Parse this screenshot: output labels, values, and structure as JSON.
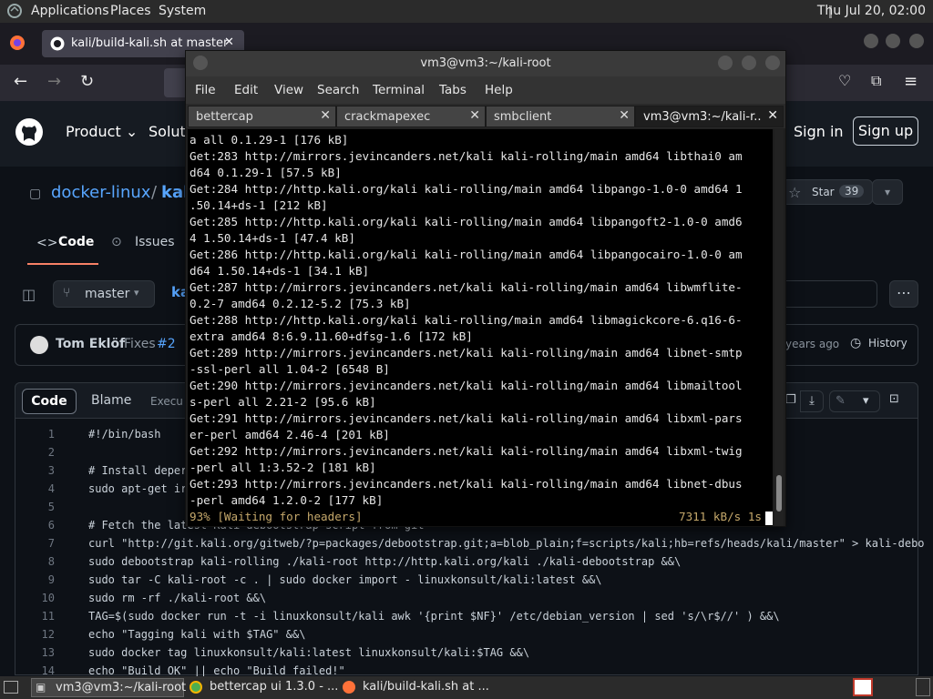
{
  "panel": {
    "applications": "Applications",
    "places": "Places",
    "system": "System",
    "clock": "Thu Jul 20, 02:00"
  },
  "firefox": {
    "tab_title": "kali/build-kali.sh at master",
    "tab_close": "✕"
  },
  "github": {
    "product": "Product",
    "solutions": "Soluti",
    "sign_in": "Sign in",
    "sign_up": "Sign up",
    "repo_owner": "docker-linux",
    "repo_sep": "/",
    "repo_name": "kal",
    "star": "Star",
    "star_count": "39",
    "tab_code": "Code",
    "tab_issues": "Issues",
    "branch": "master",
    "path_frag": "ka",
    "author": "Tom Eklöf",
    "commit_msg": "Fixes",
    "commit_ref": "#2",
    "time_ago": "years ago",
    "history": "History",
    "view_code": "Code",
    "view_blame": "Blame",
    "view_exec": "Execu",
    "code_lines": [
      {
        "n": "1",
        "t": "#!/bin/bash"
      },
      {
        "n": "2",
        "t": ""
      },
      {
        "n": "3",
        "t": "# Install deper"
      },
      {
        "n": "4",
        "t": "sudo apt-get ir"
      },
      {
        "n": "5",
        "t": ""
      },
      {
        "n": "6",
        "t": "# Fetch the latest Kali debootstrap script from git"
      },
      {
        "n": "7",
        "t": "curl \"http://git.kali.org/gitweb/?p=packages/debootstrap.git;a=blob_plain;f=scripts/kali;hb=refs/heads/kali/master\" > kali-debo"
      },
      {
        "n": "8",
        "t": "sudo debootstrap kali-rolling ./kali-root http://http.kali.org/kali ./kali-debootstrap &&\\"
      },
      {
        "n": "9",
        "t": "sudo tar -C kali-root -c . | sudo docker import - linuxkonsult/kali:latest &&\\"
      },
      {
        "n": "10",
        "t": "sudo rm -rf ./kali-root &&\\"
      },
      {
        "n": "11",
        "t": "TAG=$(sudo docker run -t -i linuxkonsult/kali awk '{print $NF}' /etc/debian_version | sed 's/\\r$//' ) &&\\"
      },
      {
        "n": "12",
        "t": "echo \"Tagging kali with $TAG\" &&\\"
      },
      {
        "n": "13",
        "t": "sudo docker tag linuxkonsult/kali:latest linuxkonsult/kali:$TAG &&\\"
      },
      {
        "n": "14",
        "t": "echo \"Build OK\" || echo \"Build failed!\""
      }
    ]
  },
  "terminal": {
    "title": "vm3@vm3:~/kali-root",
    "menu": [
      "File",
      "Edit",
      "View",
      "Search",
      "Terminal",
      "Tabs",
      "Help"
    ],
    "tabs": [
      {
        "label": "bettercap"
      },
      {
        "label": "crackmapexec"
      },
      {
        "label": "smbclient"
      },
      {
        "label": "vm3@vm3:~/kali-r..."
      }
    ],
    "tab_close": "✕",
    "lines": [
      "a all 0.1.29-1 [176 kB]",
      "Get:283 http://mirrors.jevincanders.net/kali kali-rolling/main amd64 libthai0 am",
      "d64 0.1.29-1 [57.5 kB]",
      "Get:284 http://http.kali.org/kali kali-rolling/main amd64 libpango-1.0-0 amd64 1",
      ".50.14+ds-1 [212 kB]",
      "Get:285 http://http.kali.org/kali kali-rolling/main amd64 libpangoft2-1.0-0 amd6",
      "4 1.50.14+ds-1 [47.4 kB]",
      "Get:286 http://http.kali.org/kali kali-rolling/main amd64 libpangocairo-1.0-0 am",
      "d64 1.50.14+ds-1 [34.1 kB]",
      "Get:287 http://mirrors.jevincanders.net/kali kali-rolling/main amd64 libwmflite-",
      "0.2-7 amd64 0.2.12-5.2 [75.3 kB]",
      "Get:288 http://http.kali.org/kali kali-rolling/main amd64 libmagickcore-6.q16-6-",
      "extra amd64 8:6.9.11.60+dfsg-1.6 [172 kB]",
      "Get:289 http://mirrors.jevincanders.net/kali kali-rolling/main amd64 libnet-smtp",
      "-ssl-perl all 1.04-2 [6548 B]",
      "Get:290 http://mirrors.jevincanders.net/kali kali-rolling/main amd64 libmailtool",
      "s-perl all 2.21-2 [95.6 kB]",
      "Get:291 http://mirrors.jevincanders.net/kali kali-rolling/main amd64 libxml-pars",
      "er-perl amd64 2.46-4 [201 kB]",
      "Get:292 http://mirrors.jevincanders.net/kali kali-rolling/main amd64 libxml-twig",
      "-perl all 1:3.52-2 [181 kB]",
      "Get:293 http://mirrors.jevincanders.net/kali kali-rolling/main amd64 libnet-dbus",
      "-perl amd64 1.2.0-2 [177 kB]"
    ],
    "status_left": "93% [Waiting for headers]",
    "status_right": "7311 kB/s 1s"
  },
  "taskbar": {
    "items": [
      {
        "label": "vm3@vm3:~/kali-root"
      },
      {
        "label": "bettercap ui 1.3.0 - ..."
      },
      {
        "label": "kali/build-kali.sh at ..."
      }
    ]
  },
  "colors": {
    "terminal_status": "#c5a86b",
    "github_link": "#58a6ff",
    "gh_bg": "#0d1117"
  }
}
